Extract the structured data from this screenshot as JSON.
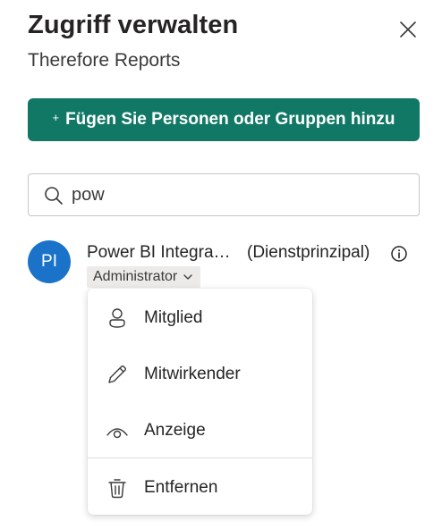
{
  "panel": {
    "title": "Zugriff verwalten",
    "subtitle": "Therefore Reports",
    "close_icon": "close-icon"
  },
  "add_button": {
    "plus": "+",
    "label": "Fügen Sie Personen oder Gruppen hinzu",
    "color": "#117865"
  },
  "search": {
    "value": "pow",
    "icon": "search-icon"
  },
  "person": {
    "initials": "PI",
    "name": "Power BI Integra…",
    "type": "(Dienstprinzipal)",
    "avatar_color": "#1a73c9",
    "role": "Administrator"
  },
  "role_menu": {
    "items": [
      {
        "label": "Mitglied",
        "icon": "member-icon"
      },
      {
        "label": "Mitwirkender",
        "icon": "pencil-icon"
      },
      {
        "label": "Anzeige",
        "icon": "eye-icon"
      },
      {
        "label": "Entfernen",
        "icon": "trash-icon"
      }
    ]
  }
}
